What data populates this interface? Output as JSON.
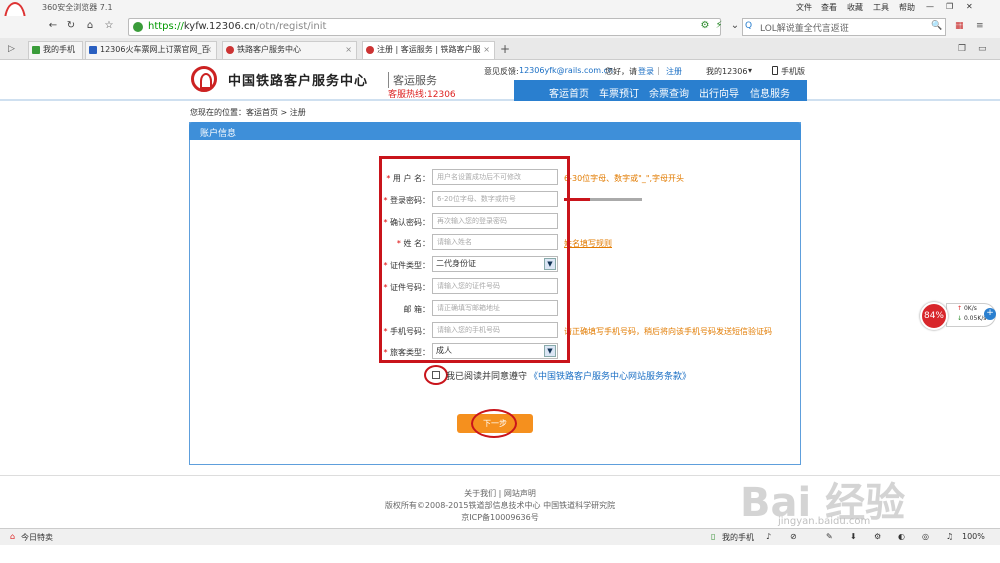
{
  "browser": {
    "title": "360安全浏览器 7.1",
    "menu": [
      "文件",
      "查看",
      "收藏",
      "工具",
      "帮助"
    ],
    "url_secure": "https://",
    "url_host": "kyfw.12306.cn",
    "url_path": "/otn/regist/init",
    "search_text": "LOL解说董全代言返诳",
    "tabs": [
      {
        "label": "我的手机",
        "active": false
      },
      {
        "label": "12306火车票网上订票官网_百度",
        "active": false
      },
      {
        "label": "铁路客户服务中心",
        "active": false
      },
      {
        "label": "注册 | 客运服务 | 铁路客户服",
        "active": true
      }
    ]
  },
  "site": {
    "name": "中国铁路客户服务中心",
    "sub": "客运服务",
    "hotline": "客服热线:12306",
    "feedback_label": "意见反馈:",
    "feedback_email": "12306yfk@rails.com.cn",
    "greeting": "您好，请",
    "login": "登录",
    "register": "注册",
    "my12306": "我的12306",
    "mobile": "手机版",
    "nav": [
      "客运首页",
      "车票预订",
      "余票查询",
      "出行向导",
      "信息服务"
    ]
  },
  "breadcrumb": "您现在的位置：客运首页 > 注册",
  "panel_title": "账户信息",
  "form": {
    "fields": [
      {
        "label": "用 户 名：",
        "placeholder": "用户名设置成功后不可修改",
        "hint": "6-30位字母、数字或\"_\",字母开头"
      },
      {
        "label": "登录密码：",
        "placeholder": "6-20位字母、数字或符号",
        "hint": ""
      },
      {
        "label": "确认密码：",
        "placeholder": "再次输入您的登录密码",
        "hint": ""
      },
      {
        "label": "姓 名：",
        "placeholder": "请输入姓名",
        "hint": "姓名填写规则"
      },
      {
        "label": "证件类型：",
        "value": "二代身份证",
        "hint": ""
      },
      {
        "label": "证件号码：",
        "placeholder": "请输入您的证件号码",
        "hint": ""
      },
      {
        "label": "邮 箱：",
        "placeholder": "请正确填写邮箱地址",
        "hint": ""
      },
      {
        "label": "手机号码：",
        "placeholder": "请输入您的手机号码",
        "hint": "请正确填写手机号码，稍后将向该手机号码发送短信验证码"
      },
      {
        "label": "旅客类型：",
        "value": "成人",
        "hint": ""
      }
    ],
    "agree_text": "我已阅读并同意遵守",
    "agree_link": "《中国铁路客户服务中心网站服务条款》",
    "next": "下一步"
  },
  "footer": {
    "links": "关于我们 | 网站声明",
    "copyright": "版权所有©2008-2015铁道部信息技术中心 中国铁道科学研究院",
    "icp": "京ICP备10009636号"
  },
  "speed": {
    "percent": "84%",
    "up": "0K/s",
    "down": "0.05K/s"
  },
  "status": {
    "left": "今日特卖",
    "phone": "我的手机",
    "zoom": "100%"
  },
  "watermark": {
    "main": "Bai 经验",
    "sub": "jingyan.baidu.com"
  },
  "colors": {
    "nav_blue": "#2a7fcf",
    "annotation_red": "#c9141b",
    "button_orange": "#f5901e",
    "hint_orange": "#e27b00"
  }
}
